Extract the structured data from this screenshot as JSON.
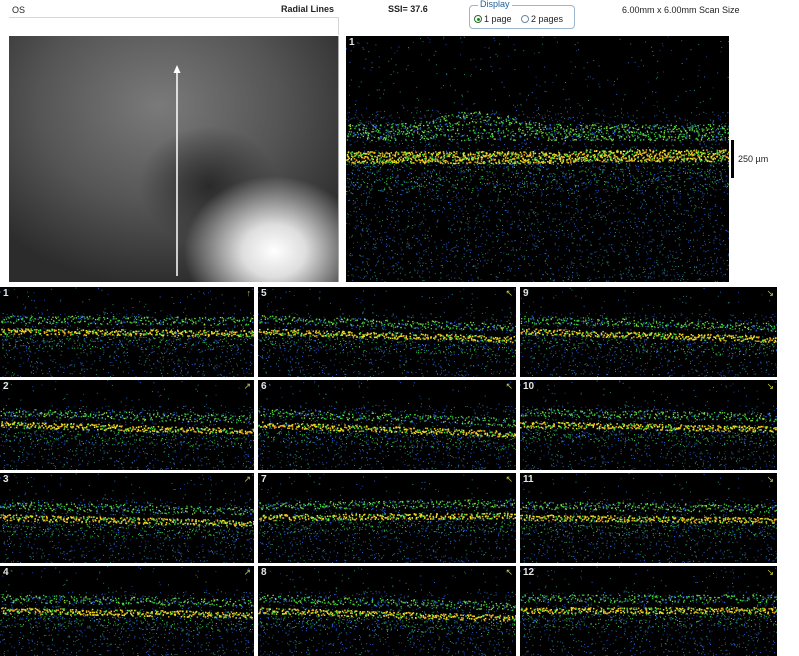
{
  "header": {
    "eye": "OS",
    "scan_type": "Radial Lines",
    "ssi": "SSI= 37.6",
    "scan_size": "6.00mm x 6.00mm Scan Size"
  },
  "display": {
    "legend": "Display",
    "options": [
      {
        "label": "1 page",
        "selected": true
      },
      {
        "label": "2 pages",
        "selected": false
      }
    ]
  },
  "main_scan": {
    "label": "1",
    "scale_label": "250 µm"
  },
  "thumbnails": [
    {
      "label": "1"
    },
    {
      "label": "2"
    },
    {
      "label": "3"
    },
    {
      "label": "4"
    },
    {
      "label": "5"
    },
    {
      "label": "6"
    },
    {
      "label": "7"
    },
    {
      "label": "8"
    },
    {
      "label": "9"
    },
    {
      "label": "10"
    },
    {
      "label": "11"
    },
    {
      "label": "12"
    }
  ],
  "colors": {
    "background": "#000000",
    "retina_yellow": "#f0e020",
    "retina_green": "#39d23a",
    "retina_orange": "#e8a020",
    "noise_blue": "#2a5fd0",
    "radio_green": "#1e8a1e"
  }
}
